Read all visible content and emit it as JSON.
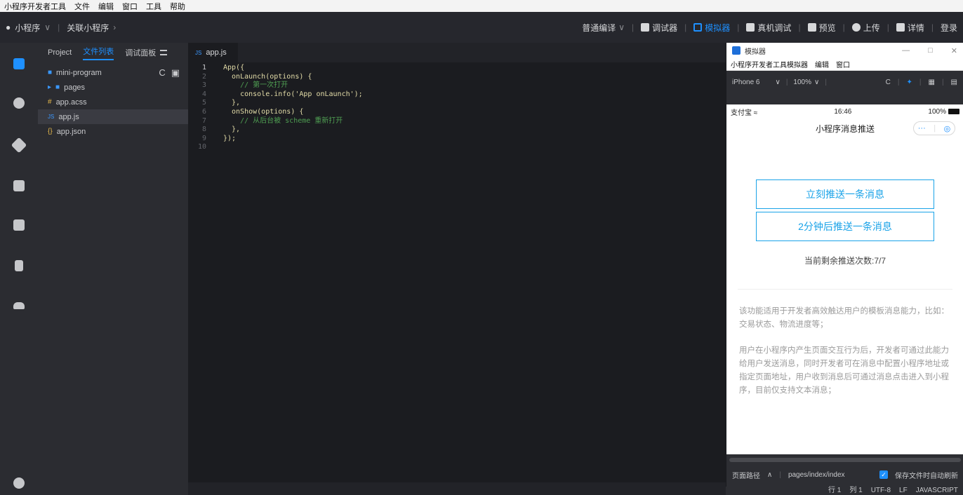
{
  "menubar": {
    "items": [
      "小程序开发者工具",
      "文件",
      "编辑",
      "窗口",
      "工具",
      "帮助"
    ]
  },
  "toolbar": {
    "project": "小程序",
    "linked": "关联小程序",
    "compile_mode": "普通编译",
    "debugger": "调试器",
    "simulator": "模拟器",
    "device_debug": "真机调试",
    "preview": "预览",
    "upload": "上传",
    "details": "详情",
    "login": "登录"
  },
  "explorer": {
    "tabs": [
      "Project",
      "文件列表",
      "调试面板"
    ],
    "root": "mini-program",
    "files": [
      {
        "name": "pages",
        "type": "folder"
      },
      {
        "name": "app.acss",
        "type": "css"
      },
      {
        "name": "app.js",
        "type": "js",
        "selected": true
      },
      {
        "name": "app.json",
        "type": "json"
      }
    ]
  },
  "editor": {
    "tab": "app.js",
    "lines": [
      {
        "n": "1",
        "t": "App({",
        "c": false
      },
      {
        "n": "2",
        "t": "  onLaunch(options) {",
        "c": false
      },
      {
        "n": "3",
        "t": "    // 第一次打开",
        "c": true
      },
      {
        "n": "4",
        "t": "    console.info('App onLaunch');",
        "c": false
      },
      {
        "n": "5",
        "t": "  },",
        "c": false
      },
      {
        "n": "6",
        "t": "  onShow(options) {",
        "c": false
      },
      {
        "n": "7",
        "t": "    // 从后台被 scheme 重新打开",
        "c": true
      },
      {
        "n": "8",
        "t": "  },",
        "c": false
      },
      {
        "n": "9",
        "t": "});",
        "c": false
      },
      {
        "n": "10",
        "t": "",
        "c": false
      }
    ]
  },
  "simulator": {
    "window_title": "模拟器",
    "menu": [
      "小程序开发者工具模拟器",
      "编辑",
      "窗口"
    ],
    "device": "iPhone 6",
    "zoom": "100%",
    "status": {
      "carrier": "支付宝",
      "time": "16:46",
      "battery": "100%"
    },
    "page_title": "小程序消息推送",
    "btn_push_now": "立刻推送一条消息",
    "btn_push_later": "2分钟后推送一条消息",
    "remaining": "当前剩余推送次数:7/7",
    "desc1": "该功能适用于开发者高效触达用户的模板消息能力，比如：交易状态、物流进度等；",
    "desc2": "用户在小程序内产生页面交互行为后，开发者可通过此能力给用户发送消息，同时开发者可在消息中配置小程序地址或指定页面地址，用户收到消息后可通过消息点击进入到小程序，目前仅支持文本消息；",
    "footer": {
      "path_label": "页面路径",
      "path": "pages/index/index",
      "auto_refresh": "保存文件时自动刷新"
    }
  },
  "statusbar": {
    "row": "行 1",
    "col": "列 1",
    "encoding": "UTF-8",
    "eol": "LF",
    "lang": "JAVASCRIPT"
  }
}
